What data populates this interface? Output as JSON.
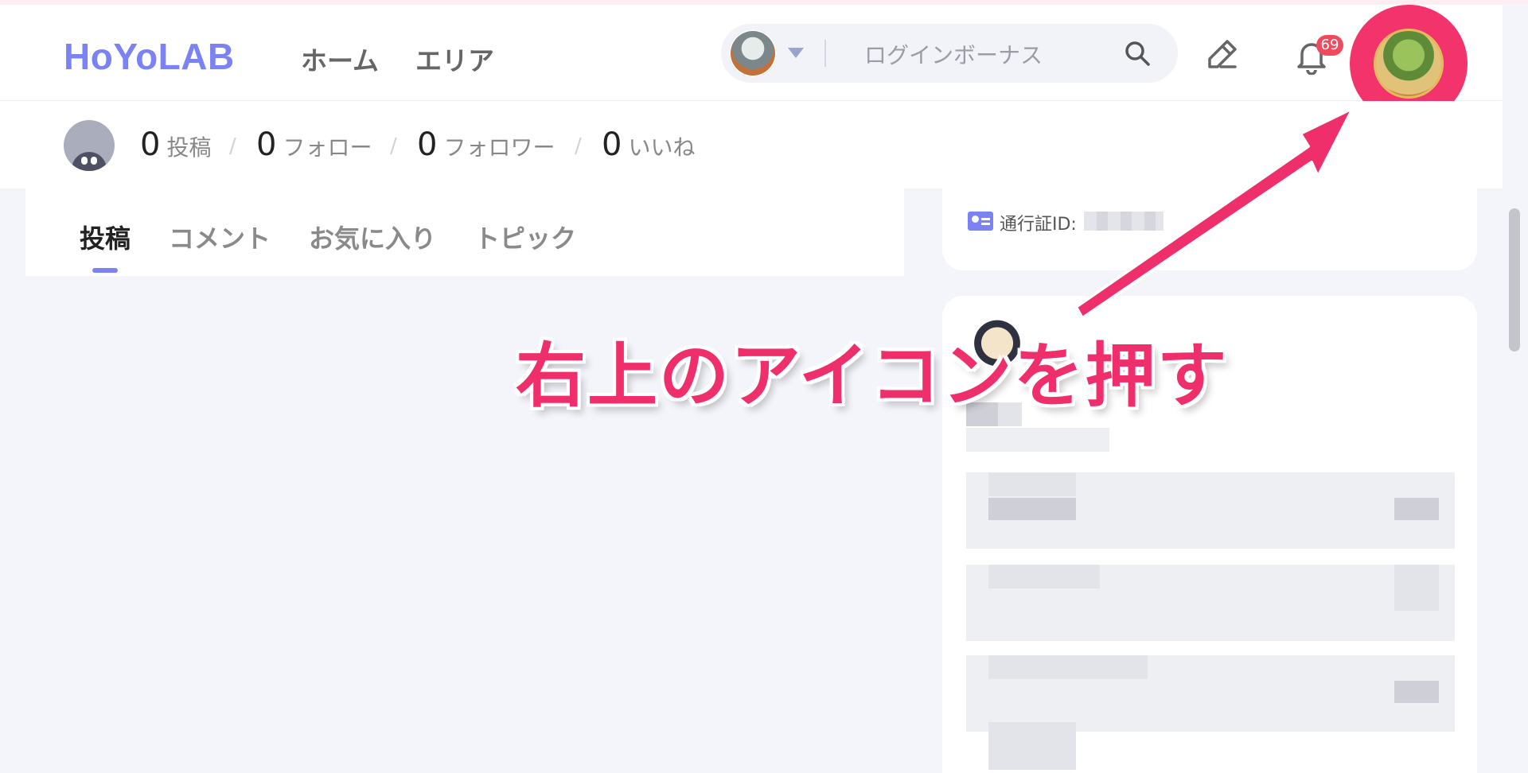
{
  "header": {
    "logo": "HoYoLAB",
    "nav": [
      "ホーム",
      "エリア"
    ],
    "search_placeholder": "ログインボーナス",
    "notification_count": "69"
  },
  "stats": [
    {
      "value": "0",
      "label": "投稿"
    },
    {
      "value": "0",
      "label": "フォロー"
    },
    {
      "value": "0",
      "label": "フォロワー"
    },
    {
      "value": "0",
      "label": "いいね"
    }
  ],
  "tabs": [
    "投稿",
    "コメント",
    "お気に入り",
    "トピック"
  ],
  "profile": {
    "id_label": "通行証ID:"
  },
  "annotation": {
    "text": "右上のアイコンを押す",
    "color": "#ee2f6b"
  },
  "colors": {
    "brand": "#7a82f4",
    "highlight": "#f3336b",
    "badge": "#ef4a5e"
  }
}
